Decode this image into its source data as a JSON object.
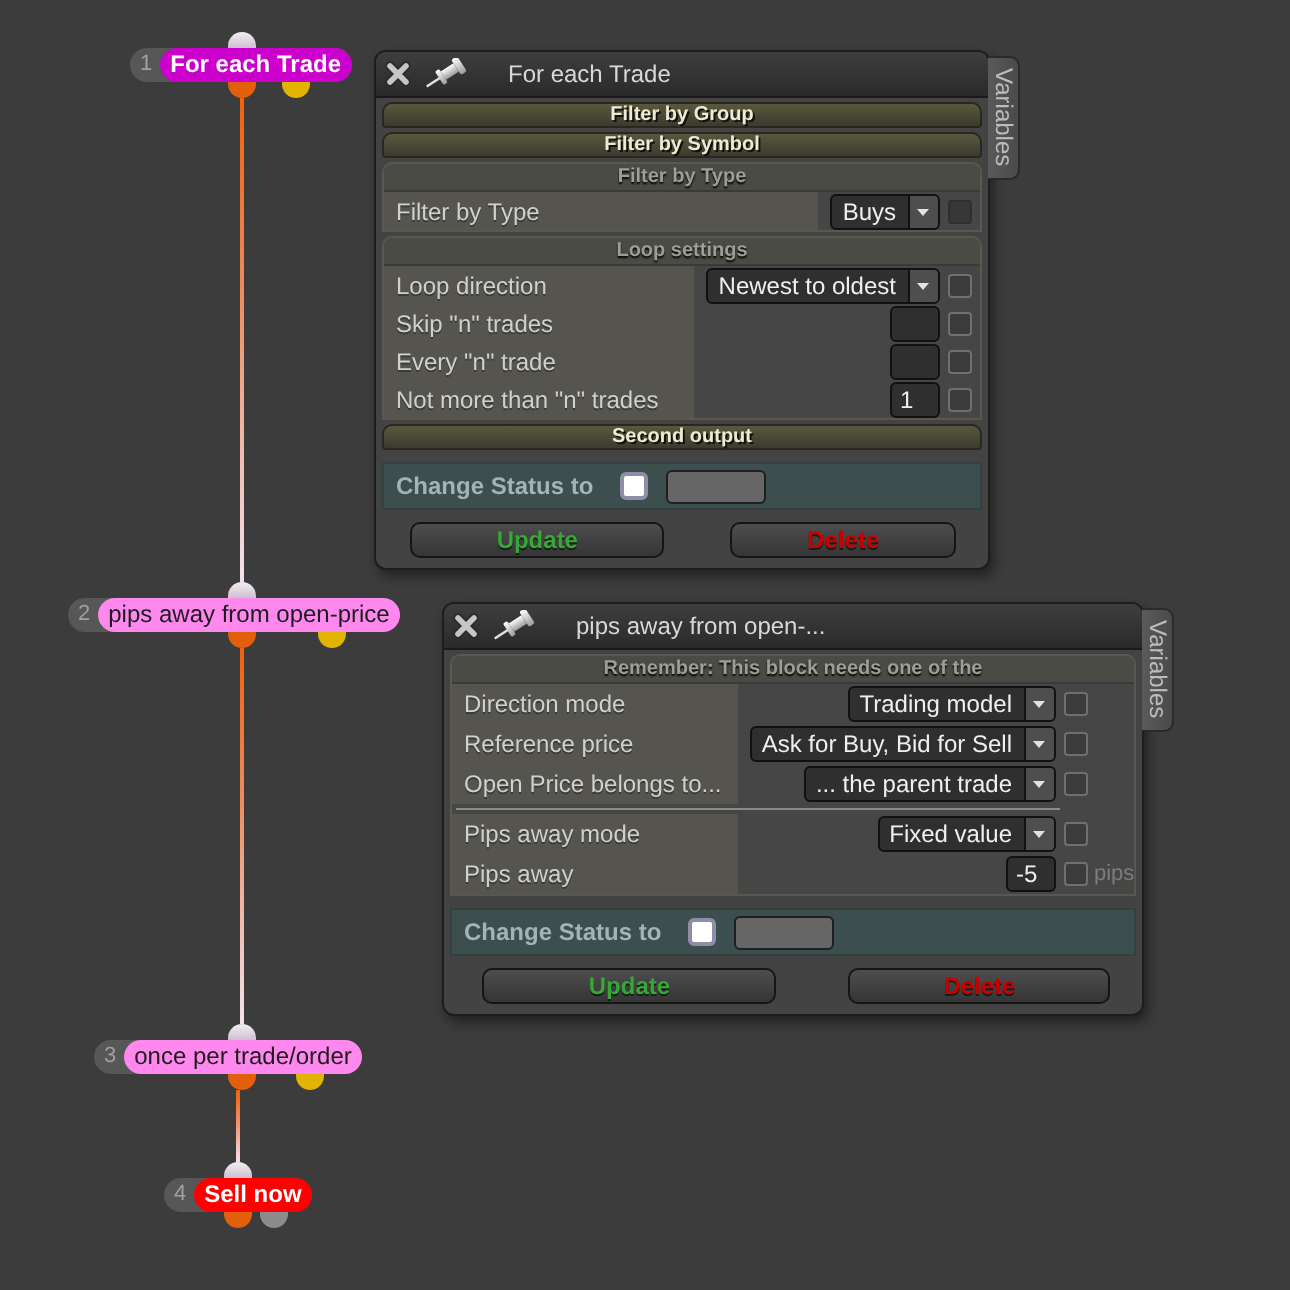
{
  "canvas": {
    "nodes": [
      {
        "number": "1",
        "label": "For each Trade",
        "kind": "loop",
        "color": "#cc00cc",
        "outputs": [
          {
            "color": "#e35f0b"
          },
          {
            "color": "#e0b400"
          }
        ]
      },
      {
        "number": "2",
        "label": "pips away from open-price",
        "kind": "condition",
        "color": "#ff88ee",
        "outputs": [
          {
            "color": "#e35f0b"
          },
          {
            "color": "#e0b400"
          }
        ]
      },
      {
        "number": "3",
        "label": "once per trade/order",
        "kind": "condition",
        "color": "#ff88ee",
        "outputs": [
          {
            "color": "#e35f0b"
          },
          {
            "color": "#e0b400"
          }
        ]
      },
      {
        "number": "4",
        "label": "Sell now",
        "kind": "action",
        "color": "#ff0000",
        "outputs": [
          {
            "color": "#e35f0b"
          },
          {
            "color": "#8c8c8c"
          }
        ]
      }
    ]
  },
  "panels": [
    {
      "title": "For each Trade",
      "side_tab": "Variables",
      "sections": [
        {
          "kind": "header",
          "title": "Filter by Group"
        },
        {
          "kind": "header",
          "title": "Filter by Symbol"
        },
        {
          "kind": "group",
          "title": "Filter by Type",
          "rows": [
            {
              "kind": "dropdown",
              "label": "Filter by Type",
              "value": "Buys",
              "checkbox": {
                "checked": false,
                "disabled": true
              }
            }
          ]
        },
        {
          "kind": "group",
          "title": "Loop settings",
          "rows": [
            {
              "kind": "dropdown",
              "label": "Loop direction",
              "value": "Newest to oldest",
              "checkbox": {
                "checked": false,
                "disabled": false
              }
            },
            {
              "kind": "input",
              "label": "Skip \"n\" trades",
              "checkbox": {
                "checked": false,
                "disabled": false
              }
            },
            {
              "kind": "input",
              "label": "Every \"n\" trade",
              "checkbox": {
                "checked": false,
                "disabled": false
              }
            },
            {
              "kind": "input",
              "label": "Not more than \"n\" trades",
              "value": "1",
              "checkbox": {
                "checked": false,
                "disabled": false
              }
            }
          ]
        },
        {
          "kind": "header",
          "title": "Second output"
        }
      ],
      "status": {
        "label": "Change Status to",
        "checked": false
      },
      "buttons": [
        {
          "kind": "update",
          "label": "Update"
        },
        {
          "kind": "delete",
          "label": "Delete"
        }
      ]
    },
    {
      "title": "pips away from open-...",
      "side_tab": "Variables",
      "sections": [
        {
          "kind": "group",
          "title": "Remember: This block needs one of the",
          "rows": [
            {
              "kind": "dropdown",
              "label": "Direction mode",
              "value": "Trading model",
              "checkbox": {
                "checked": false,
                "disabled": false
              }
            },
            {
              "kind": "dropdown",
              "label": "Reference price",
              "value": "Ask for Buy, Bid for Sell",
              "checkbox": {
                "checked": false,
                "disabled": false
              }
            },
            {
              "kind": "dropdown",
              "label": "Open Price belongs to...",
              "value": "... the parent trade",
              "checkbox": {
                "checked": false,
                "disabled": false
              }
            },
            {
              "kind": "divider"
            },
            {
              "kind": "dropdown",
              "label": "Pips away mode",
              "value": "Fixed value",
              "checkbox": {
                "checked": false,
                "disabled": false
              }
            },
            {
              "kind": "input",
              "label": "Pips away",
              "value": "-5",
              "unit": "pips",
              "checkbox": {
                "checked": false,
                "disabled": false
              }
            }
          ]
        }
      ],
      "status": {
        "label": "Change Status to",
        "checked": false
      },
      "buttons": [
        {
          "kind": "update",
          "label": "Update"
        },
        {
          "kind": "delete",
          "label": "Delete"
        }
      ]
    }
  ]
}
